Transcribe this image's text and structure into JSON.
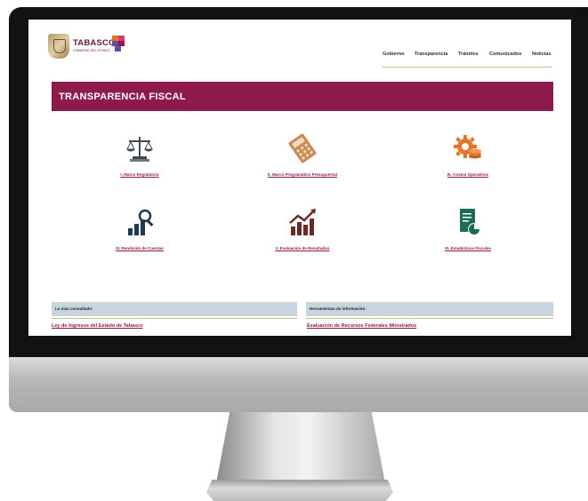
{
  "header": {
    "logo": {
      "brand": "TABASCO",
      "subtitle": "GOBIERNO DEL ESTADO",
      "mark_colors": [
        "#e2762a",
        "#8e1a4c",
        "#6a4aa0",
        "#d43b6e"
      ]
    },
    "nav": [
      {
        "label": "Gobierno"
      },
      {
        "label": "Transparencia"
      },
      {
        "label": "Trámites"
      },
      {
        "label": "Comunicados"
      },
      {
        "label": "Noticias"
      }
    ]
  },
  "banner": {
    "title": "TRANSPARENCIA FISCAL",
    "color": "#8e1a4c"
  },
  "tiles": [
    {
      "label": "I. Marco Regulatorio",
      "icon": "scales-icon"
    },
    {
      "label": "II. Marco Programático Presupuestal",
      "icon": "calculator-icon"
    },
    {
      "label": "III. Costos Operativos",
      "icon": "gear-coins-icon"
    },
    {
      "label": "IV. Rendición de Cuentas",
      "icon": "chart-magnifier-icon"
    },
    {
      "label": "V. Evaluación de Resultados",
      "icon": "growth-chart-icon"
    },
    {
      "label": "VI. Estadísticas Fiscales",
      "icon": "document-chart-icon"
    }
  ],
  "panels": {
    "most_viewed": {
      "heading": "Lo más consultado:",
      "link": "Ley de Ingresos del Estado de Tabasco"
    },
    "tools": {
      "heading": "Herramientas de información:",
      "link": "Evaluación de Recursos Federales Ministrados"
    }
  },
  "colors": {
    "accent": "#8e1a4c",
    "icon_dark": "#1f3a4d",
    "icon_orange": "#e2762a",
    "icon_green": "#1e6b58"
  }
}
